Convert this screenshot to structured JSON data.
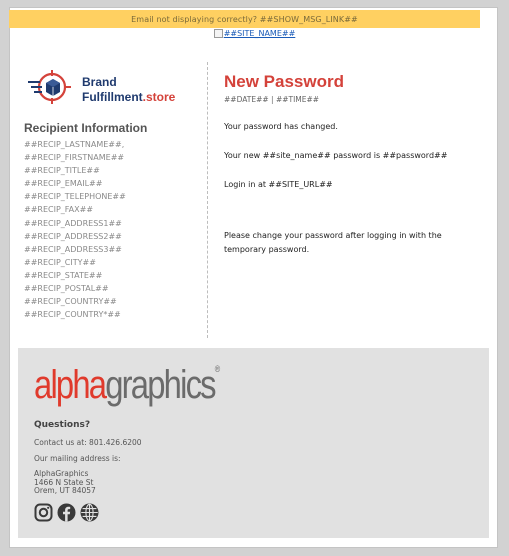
{
  "notice_bar": {
    "text": "Email not displaying correctly? ##SHOW_MSG_LINK##",
    "color": "#ffd061"
  },
  "site_link": {
    "text": "##SITE_NAME##"
  },
  "brand": {
    "line1": "Brand",
    "line2_main": "Fulfillment",
    "line2_tld": ".store",
    "primary_color": "#1f3a6e",
    "accent_color": "#d4423a"
  },
  "recipient": {
    "heading": "Recipient Information",
    "fields": [
      "##RECIP_LASTNAME##,",
      "##RECIP_FIRSTNAME##",
      "##RECIP_TITLE##",
      "##RECIP_EMAIL##",
      "##RECIP_TELEPHONE##",
      "##RECIP_FAX##",
      "##RECIP_ADDRESS1##",
      "##RECIP_ADDRESS2##",
      "##RECIP_ADDRESS3##",
      "##RECIP_CITY##",
      "##RECIP_STATE##",
      "##RECIP_POSTAL##",
      "##RECIP_COUNTRY##",
      "##RECIP_COUNTRY*##"
    ]
  },
  "message": {
    "title": "New Password",
    "datetime": "##DATE## | ##TIME##",
    "line1": "Your password has changed.",
    "line2": "Your new ##site_name## password is ##password##",
    "line3": "Login in at ##SITE_URL##",
    "line4": "Please change your password after logging in with the temporary password."
  },
  "footer": {
    "logo_alpha": "alpha",
    "logo_graphics": "graphics",
    "logo_reg": "®",
    "questions": "Questions?",
    "contact": "Contact us at: 801.426.6200",
    "mailing": "Our mailing address is:",
    "address_lines": [
      "AlphaGraphics",
      "1466 N State St",
      "Orem, UT 84057"
    ],
    "social_icons": [
      "instagram-icon",
      "facebook-icon",
      "website-globe-icon"
    ]
  }
}
